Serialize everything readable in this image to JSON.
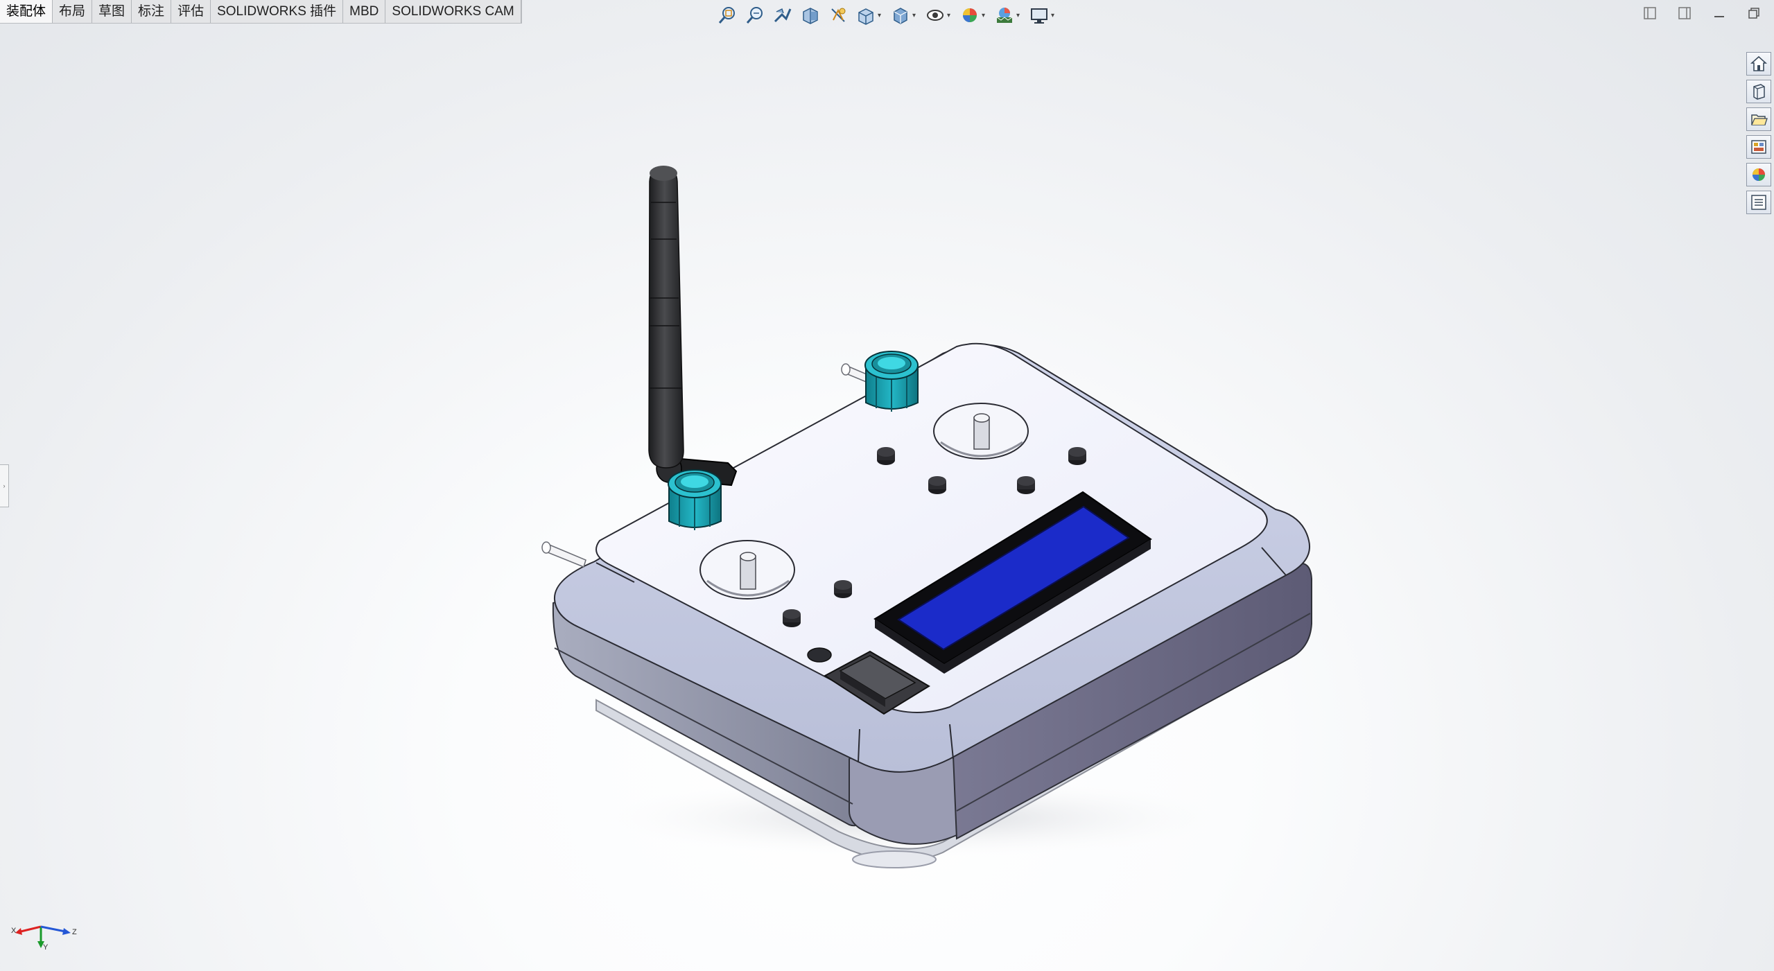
{
  "tabs": [
    {
      "label": "装配体",
      "active": true
    },
    {
      "label": "布局"
    },
    {
      "label": "草图"
    },
    {
      "label": "标注"
    },
    {
      "label": "评估"
    },
    {
      "label": "SOLIDWORKS 插件"
    },
    {
      "label": "MBD"
    },
    {
      "label": "SOLIDWORKS CAM"
    }
  ],
  "hud_toolbar": {
    "icons": [
      "zoom-to-fit-icon",
      "zoom-to-area-icon",
      "previous-view-icon",
      "section-view-icon",
      "dynamic-annotation-icon",
      "view-orientation-icon",
      "display-style-icon",
      "hide-show-items-icon",
      "edit-appearance-icon",
      "apply-scene-icon",
      "view-settings-icon"
    ]
  },
  "window_controls": [
    "tile-left-icon",
    "tile-right-icon",
    "minimize-icon",
    "restore-icon"
  ],
  "task_pane": [
    "solidworks-resources-icon",
    "design-library-icon",
    "file-explorer-icon",
    "view-palette-icon",
    "appearances-scenes-icon",
    "custom-properties-icon"
  ],
  "triad": {
    "x_label": "X",
    "y_label": "Y",
    "z_label": "Z"
  },
  "colors": {
    "knob": "#1fa6b6",
    "lcd": "#1b28c8",
    "body": "#c7ccdb",
    "top_plate": "#eef0fa",
    "antenna": "#2b2c2e"
  }
}
